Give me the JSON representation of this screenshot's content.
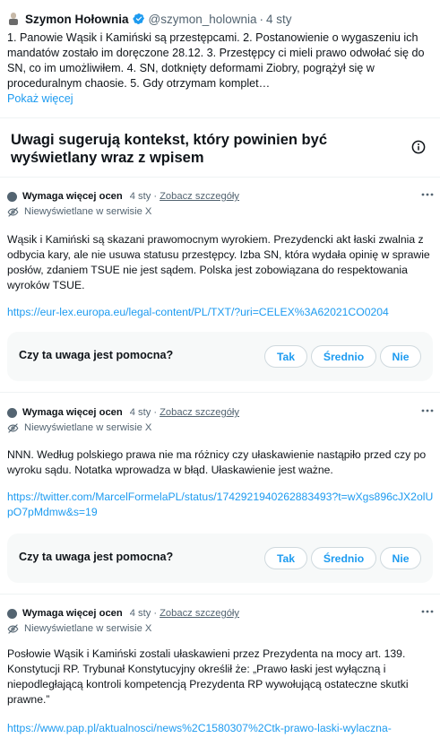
{
  "tweet": {
    "author_name": "Szymon Hołownia",
    "handle": "@szymon_holownia",
    "separator": "·",
    "date": "4 sty",
    "text": "1. Panowie Wąsik i Kamiński są przestępcami. 2. Postanowienie o wygaszeniu ich mandatów zostało im doręczone 28.12. 3. Przestępcy ci mieli prawo odwołać się do SN, co im umożliwiłem. 4. SN, dotknięty deformami Ziobry, pogrążył się w proceduralnym chaosie. 5. Gdy otrzymam komplet…",
    "show_more": "Pokaż więcej",
    "verified_color": "#1d9bf0"
  },
  "section": {
    "title": "Uwagi sugerują kontekst, który powinien być wyświetlany wraz z wpisem"
  },
  "notes": [
    {
      "status": "Wymaga więcej ocen",
      "date": "4 sty",
      "separator": "·",
      "details": "Zobacz szczegóły",
      "visibility": "Niewyświetlane w serwisie X",
      "body": "Wąsik i Kamiński są skazani prawomocnym wyrokiem. Prezydencki akt łaski zwalnia z odbycia kary, ale nie usuwa statusu przestępcy. Izba SN, która wydała opinię w sprawie posłów, zdaniem TSUE nie jest sądem. Polska jest zobowiązana do respektowania wyroków TSUE.",
      "link": "https://eur-lex.europa.eu/legal-content/PL/TXT/?uri=CELEX%3A62021CO0204",
      "rating_question": "Czy ta uwaga jest pomocna?",
      "buttons": [
        "Tak",
        "Średnio",
        "Nie"
      ]
    },
    {
      "status": "Wymaga więcej ocen",
      "date": "4 sty",
      "separator": "·",
      "details": "Zobacz szczegóły",
      "visibility": "Niewyświetlane w serwisie X",
      "body": "NNN. Według polskiego prawa nie ma różnicy czy ułaskawienie nastąpiło przed czy po wyroku sądu. Notatka wprowadza w błąd. Ułaskawienie jest ważne.",
      "link": "https://twitter.com/MarcelFormelaPL/status/1742921940262883493?t=wXgs896cJX2olUpO7pMdmw&s=19",
      "rating_question": "Czy ta uwaga jest pomocna?",
      "buttons": [
        "Tak",
        "Średnio",
        "Nie"
      ]
    },
    {
      "status": "Wymaga więcej ocen",
      "date": "4 sty",
      "separator": "·",
      "details": "Zobacz szczegóły",
      "visibility": "Niewyświetlane w serwisie X",
      "body": "Posłowie Wąsik i Kamiński zostali ułaskawieni przez Prezydenta na mocy art. 139. Konstytucji RP. Trybunał Konstytucyjny określił że: „Prawo łaski jest wyłączną i niepodległającą kontroli kompetencją Prezydenta RP wywołującą ostateczne skutki prawne.”",
      "link": "https://www.pap.pl/aktualnosci/news%2C1580307%2Ctk-prawo-laski-wylaczna-"
    }
  ],
  "colors": {
    "accent": "#1d9bf0",
    "muted": "#536471",
    "rate_box": "#f7f9f9"
  }
}
